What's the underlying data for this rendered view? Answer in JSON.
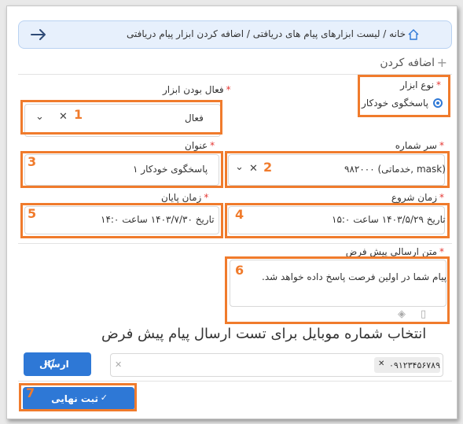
{
  "breadcrumb": {
    "text": "خانه / لیست ابزارهای پیام های دریافتی / اضافه کردن ابزار پیام دریافتی"
  },
  "page": {
    "title": "اضافه کردن",
    "plus": "+"
  },
  "tool_type": {
    "label": "نوع ابزار",
    "required": "*",
    "option": "پاسخگوی خودکار"
  },
  "tool_active": {
    "label": "فعال بودن ابزار",
    "required": "*",
    "value": "فعال",
    "marker": "1"
  },
  "sender_number": {
    "label": "سر شماره",
    "required": "*",
    "value": "(mask ,خدماتی) ۹۸۲۰۰۰",
    "marker": "2"
  },
  "title_field": {
    "label": "عنوان",
    "required": "*",
    "value": "پاسخگوی خودکار ۱",
    "marker": "3"
  },
  "start_time": {
    "label": "زمان شروع",
    "required": "*",
    "value": "تاریخ ۱۴۰۳/۵/۲۹ ساعت ۱۵:۰",
    "marker": "4"
  },
  "end_time": {
    "label": "زمان پایان",
    "required": "*",
    "value": "تاریخ ۱۴۰۳/۷/۳۰ ساعت ۱۴:۰",
    "marker": "5"
  },
  "default_text": {
    "label": "متن ارسالی پیش فرض",
    "required": "*",
    "value": "پیام شما در اولین فرصت پاسخ داده خواهد شد.",
    "marker": "6"
  },
  "test_section": {
    "heading": "انتخاب شماره موبایل برای تست ارسال پیام پیش فرض",
    "chip": "۰۹۱۲۳۴۵۶۷۸۹",
    "send_label": "ارسال"
  },
  "submit": {
    "label": "ثبت نهایی",
    "marker": "7"
  },
  "colors": {
    "accent": "#2e78d6",
    "highlight": "#f07b2c",
    "required": "#e53935"
  }
}
